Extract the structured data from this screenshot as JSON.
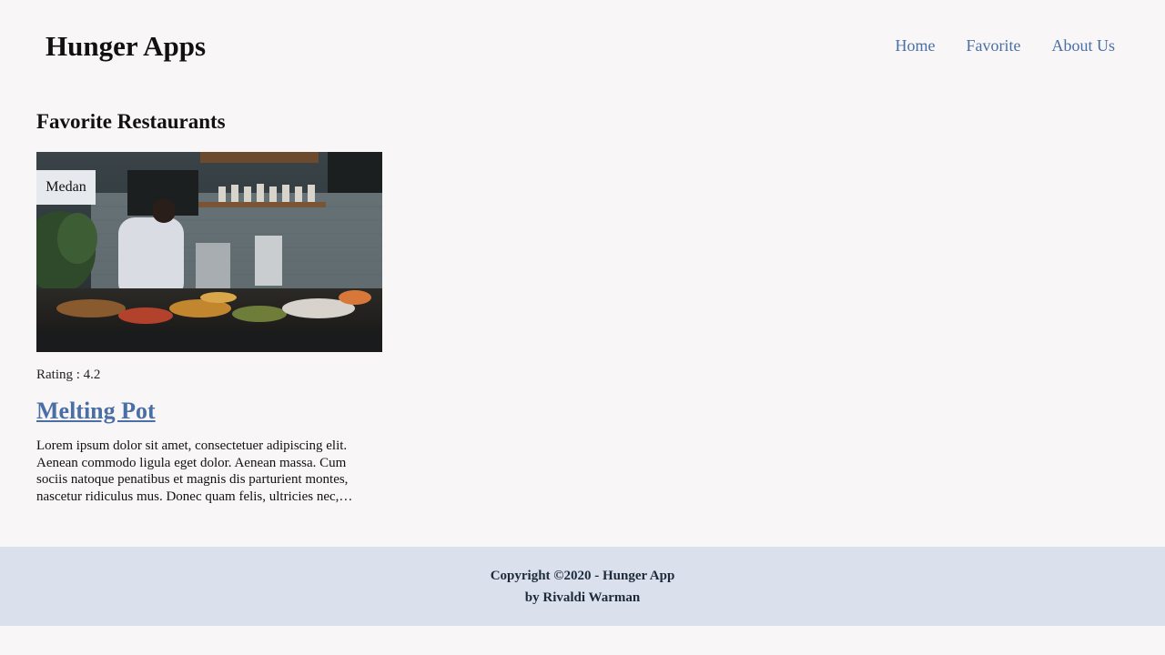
{
  "header": {
    "brand": "Hunger Apps",
    "nav": [
      {
        "label": "Home"
      },
      {
        "label": "Favorite"
      },
      {
        "label": "About Us"
      }
    ]
  },
  "main": {
    "section_title": "Favorite Restaurants",
    "restaurants": [
      {
        "city": "Medan",
        "rating_text": "Rating : 4.2",
        "name": "Melting Pot",
        "description": "Lorem ipsum dolor sit amet, consectetuer adipiscing elit. Aenean commodo ligula eget dolor. Aenean massa. Cum sociis natoque penatibus et magnis dis parturient montes, nascetur ridiculus mus. Donec quam felis, ultricies nec, pellentesque eu, pretium quis, sem."
      }
    ]
  },
  "footer": {
    "copyright": "Copyright ©2020 - Hunger App",
    "author": "by Rivaldi Warman"
  },
  "colors": {
    "background": "#f8f6f7",
    "link": "#4a6fa5",
    "footer_bg": "#dae1ed"
  }
}
